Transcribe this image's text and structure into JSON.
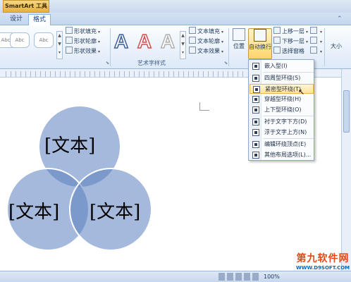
{
  "window": {
    "context_title": "SmartArt 工具"
  },
  "tabs": [
    {
      "label": "设计"
    },
    {
      "label": "格式"
    }
  ],
  "ribbon": {
    "shape_styles": {
      "samples": [
        "Abc",
        "Abc",
        "Abc"
      ],
      "fill": "形状填充",
      "outline": "形状轮廓",
      "effects": "形状效果"
    },
    "wordart": {
      "samples": [
        "A",
        "A",
        "A"
      ],
      "group_label": "艺术字样式",
      "text_fill": "文本填充",
      "text_outline": "文本轮廓",
      "text_effects": "文本效果"
    },
    "arrange": {
      "position": "位置",
      "auto_wrap": "自动换行",
      "bring_forward": "上移一层",
      "send_backward": "下移一层",
      "selection_pane": "选择窗格"
    },
    "size": "大小"
  },
  "menu": {
    "items": [
      {
        "label": "嵌入型(I)"
      },
      {
        "label": "四周型环绕(S)"
      },
      {
        "label": "紧密型环绕(T)"
      },
      {
        "label": "穿越型环绕(H)"
      },
      {
        "label": "上下型环绕(O)"
      },
      {
        "label": "衬于文字下方(D)"
      },
      {
        "label": "浮于文字上方(N)"
      },
      {
        "label": "编辑环绕顶点(E)"
      },
      {
        "label": "其他布局选项(L)..."
      }
    ]
  },
  "venn": {
    "labels": [
      "[文本]",
      "[文本]",
      "[文本]"
    ],
    "fill": "#5b7fc0"
  },
  "status": {
    "zoom": "100%"
  },
  "watermark": {
    "brand": "第九软件网",
    "url": "WWW.D9SOFT.COM"
  },
  "colors": {
    "accent": "#ffd56b",
    "ribbon": "#dde9f7"
  }
}
